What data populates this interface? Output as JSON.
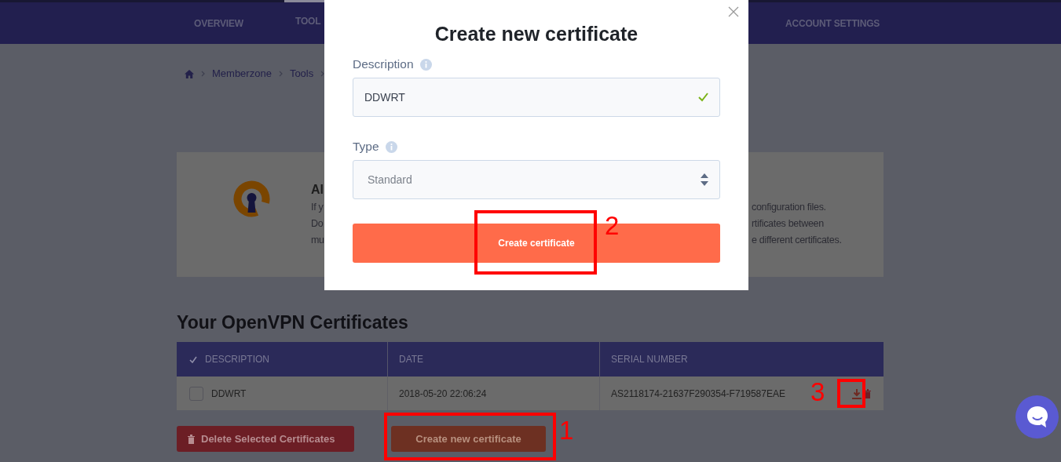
{
  "nav": {
    "items": [
      {
        "label": "OVERVIEW",
        "selected": false
      },
      {
        "label": "TOOL",
        "selected": true
      },
      {
        "label": "ACCOUNT SETTINGS",
        "selected": false
      }
    ]
  },
  "breadcrumb": [
    "Memberzone",
    "Tools"
  ],
  "info_card": {
    "title": "Al",
    "left_lines": [
      "If y",
      "Do",
      "mu"
    ],
    "right_lines": [
      "configuration files.",
      "rtificates between",
      "e different certificates."
    ]
  },
  "section_title": "Your OpenVPN Certificates",
  "table": {
    "columns": [
      "DESCRIPTION",
      "DATE",
      "SERIAL NUMBER"
    ],
    "rows": [
      {
        "checked": false,
        "description": "DDWRT",
        "date": "2018-05-20 22:06:24",
        "serial": "AS2118174-21637F290354-F719587EAE"
      }
    ]
  },
  "actions": {
    "delete": "Delete Selected Certificates",
    "create": "Create new certificate"
  },
  "modal": {
    "title": "Create new certificate",
    "description": {
      "label": "Description",
      "value": "DDWRT",
      "valid": true
    },
    "type": {
      "label": "Type",
      "value": "Standard"
    },
    "submit": "Create certificate"
  },
  "annotations": [
    {
      "label": "1"
    },
    {
      "label": "2"
    },
    {
      "label": "3"
    }
  ]
}
